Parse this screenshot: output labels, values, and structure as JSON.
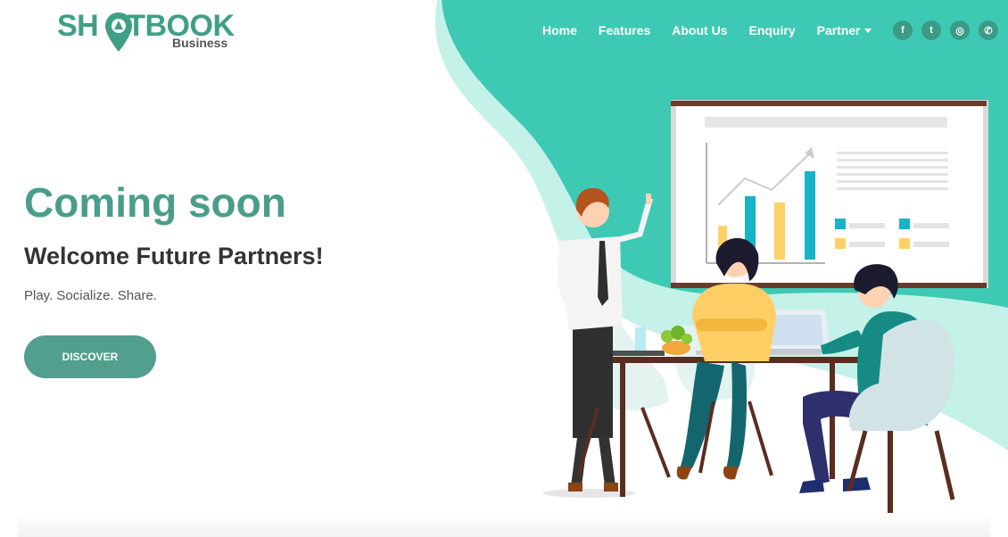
{
  "brand": {
    "logo_prefix": "SH",
    "logo_suffix": "TBOOK",
    "logo_sub": "Business"
  },
  "nav": {
    "items": [
      {
        "label": "Home"
      },
      {
        "label": "Features"
      },
      {
        "label": "About Us"
      },
      {
        "label": "Enquiry"
      },
      {
        "label": "Partner"
      }
    ]
  },
  "socials": [
    {
      "icon": "facebook-icon",
      "glyph": "f"
    },
    {
      "icon": "twitter-icon",
      "glyph": "t"
    },
    {
      "icon": "instagram-icon",
      "glyph": "◎"
    },
    {
      "icon": "whatsapp-icon",
      "glyph": "✆"
    }
  ],
  "hero": {
    "title": "Coming soon",
    "subtitle": "Welcome Future Partners!",
    "tagline": "Play. Socialize. Share.",
    "button_label": "DISCOVER"
  },
  "colors": {
    "accent": "#3ec9b4",
    "accent_light": "#c4f1e8",
    "brand_green": "#4a9e89",
    "button": "#519f8c"
  }
}
